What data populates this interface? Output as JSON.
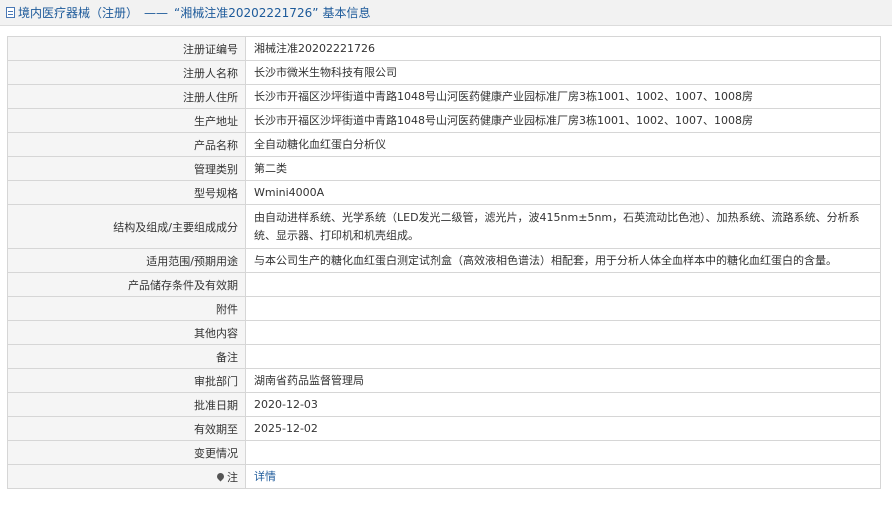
{
  "header": {
    "category": "境内医疗器械（注册）",
    "separator": "——",
    "record_name": "“湘械注准20202221726”",
    "suffix": "基本信息"
  },
  "rows": [
    {
      "label": "注册证编号",
      "value": "湘械注准20202221726"
    },
    {
      "label": "注册人名称",
      "value": "长沙市微米生物科技有限公司"
    },
    {
      "label": "注册人住所",
      "value": "长沙市开福区沙坪街道中青路1048号山河医药健康产业园标准厂房3栋1001、1002、1007、1008房"
    },
    {
      "label": "生产地址",
      "value": "长沙市开福区沙坪街道中青路1048号山河医药健康产业园标准厂房3栋1001、1002、1007、1008房"
    },
    {
      "label": "产品名称",
      "value": "全自动糖化血红蛋白分析仪"
    },
    {
      "label": "管理类别",
      "value": "第二类"
    },
    {
      "label": "型号规格",
      "value": "Wmini4000A"
    },
    {
      "label": "结构及组成/主要组成成分",
      "value": "由自动进样系统、光学系统（LED发光二级管，滤光片，波415nm±5nm，石英流动比色池）、加热系统、流路系统、分析系统、显示器、打印机和机壳组成。"
    },
    {
      "label": "适用范围/预期用途",
      "value": "与本公司生产的糖化血红蛋白测定试剂盒（高效液相色谱法）相配套，用于分析人体全血样本中的糖化血红蛋白的含量。"
    },
    {
      "label": "产品储存条件及有效期",
      "value": ""
    },
    {
      "label": "附件",
      "value": ""
    },
    {
      "label": "其他内容",
      "value": ""
    },
    {
      "label": "备注",
      "value": ""
    },
    {
      "label": "审批部门",
      "value": "湖南省药品监督管理局"
    },
    {
      "label": "批准日期",
      "value": "2020-12-03"
    },
    {
      "label": "有效期至",
      "value": "2025-12-02"
    },
    {
      "label": "变更情况",
      "value": ""
    }
  ],
  "note": {
    "label": "注",
    "icon": "pin-icon",
    "link_text": "详情"
  },
  "colors": {
    "title": "#1d5a9a",
    "label_bg": "#f5f5f5",
    "border": "#d6d6d6",
    "link": "#1d5a9a"
  }
}
